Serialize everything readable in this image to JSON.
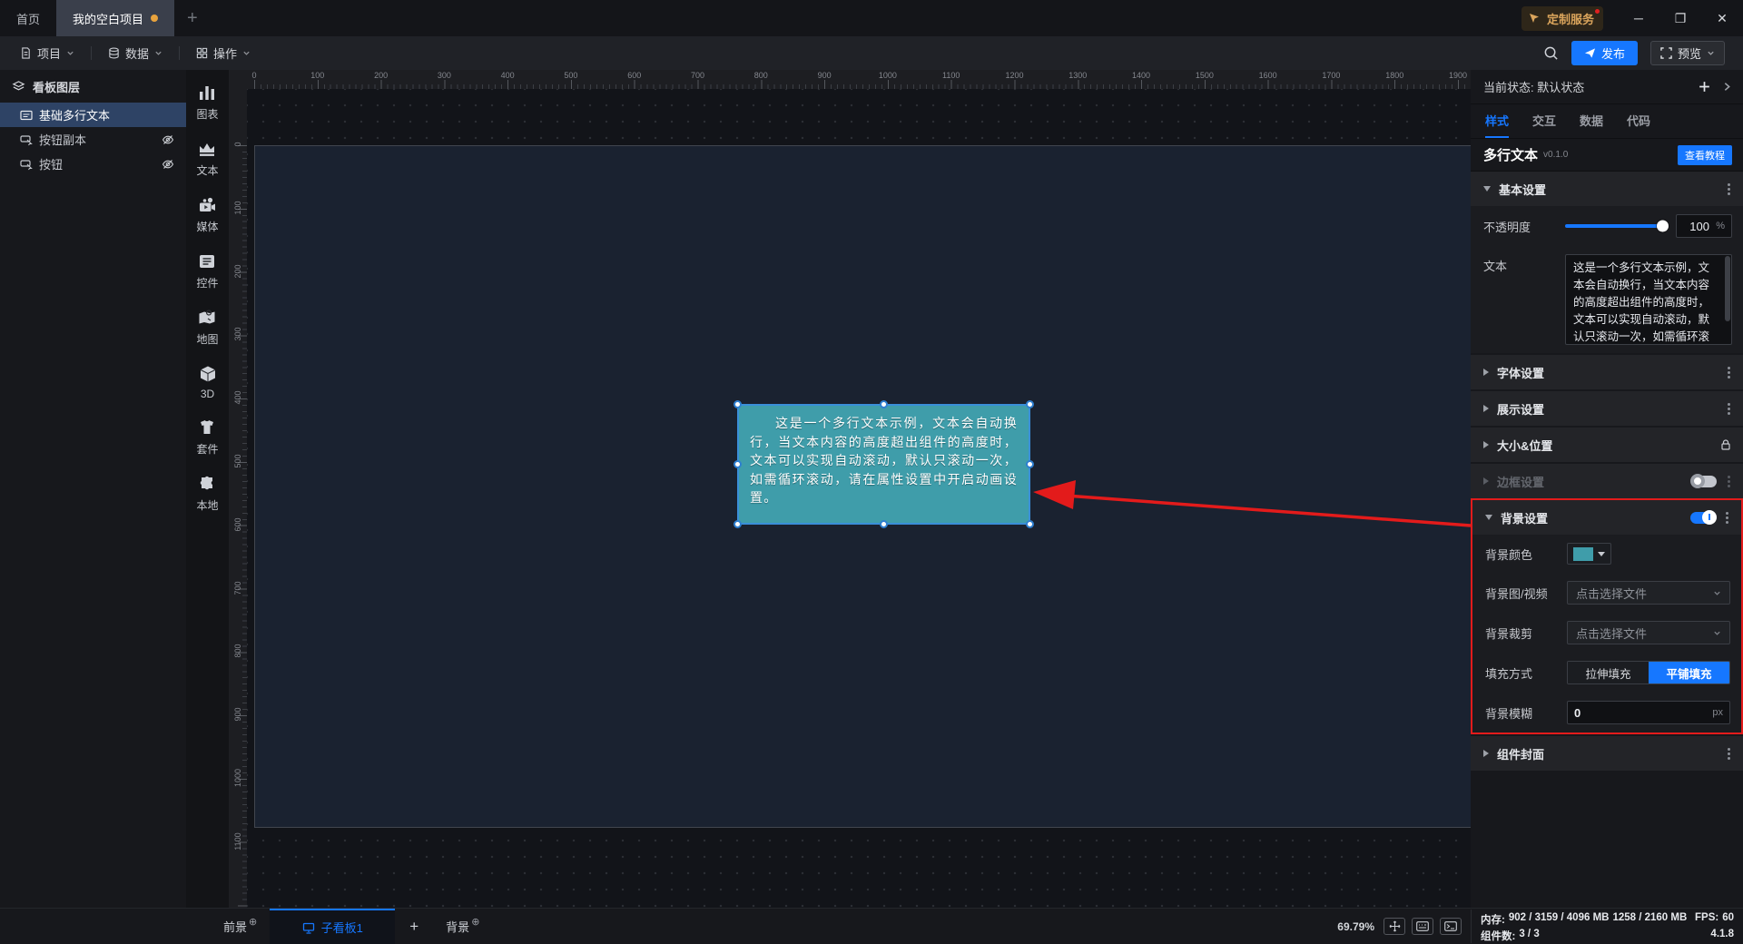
{
  "colors": {
    "accent": "#1677ff",
    "highlight_red": "#e31b1b",
    "component_teal": "#3f9daa",
    "modified_dot": "#e8a33d"
  },
  "top_bar": {
    "home_tab": "首页",
    "project_tab": "我的空白项目",
    "custom_service": "定制服务",
    "minimize": "─",
    "maximize": "❐",
    "close": "✕"
  },
  "menu_bar": {
    "items": [
      {
        "label": "项目"
      },
      {
        "label": "数据"
      },
      {
        "label": "操作"
      }
    ],
    "publish": "发布",
    "preview": "预览"
  },
  "layers_panel": {
    "title": "看板图层",
    "items": [
      {
        "label": "基础多行文本"
      },
      {
        "label": "按钮副本"
      },
      {
        "label": "按钮"
      }
    ]
  },
  "asset_toolbar": {
    "items": [
      {
        "label": "图表"
      },
      {
        "label": "文本"
      },
      {
        "label": "媒体"
      },
      {
        "label": "控件"
      },
      {
        "label": "地图"
      },
      {
        "label": "3D"
      },
      {
        "label": "套件"
      },
      {
        "label": "本地"
      }
    ]
  },
  "canvas": {
    "h_ruler": [
      0,
      100,
      200,
      300,
      400,
      500,
      600,
      700,
      800,
      900,
      1000,
      1100,
      1200,
      1300,
      1400,
      1500,
      1600,
      1700,
      1800,
      1900
    ],
    "v_ruler": [
      0,
      100,
      200,
      300,
      400,
      500,
      600,
      700,
      800,
      900,
      1000,
      1100
    ],
    "component_text": "这是一个多行文本示例，文本会自动换行，当文本内容的高度超出组件的高度时，文本可以实现自动滚动，默认只滚动一次，如需循环滚动，请在属性设置中开启动画设置。"
  },
  "inspector": {
    "state_label": "当前状态: 默认状态",
    "tabs": [
      {
        "label": "样式"
      },
      {
        "label": "交互"
      },
      {
        "label": "数据"
      },
      {
        "label": "代码"
      }
    ],
    "component_name": "多行文本",
    "component_version": "v0.1.0",
    "tutorial_button": "查看教程",
    "basic": {
      "title": "基本设置",
      "opacity_label": "不透明度",
      "opacity_value": "100",
      "opacity_unit": "%",
      "text_label": "文本",
      "text_value": "这是一个多行文本示例，文本会自动换行，当文本内容的高度超出组件的高度时，文本可以实现自动滚动，默认只滚动一次，如需循环滚动，请在属性设置中开启动画设置。"
    },
    "font": {
      "title": "字体设置"
    },
    "display": {
      "title": "展示设置"
    },
    "size": {
      "title": "大小&位置"
    },
    "border": {
      "title": "边框设置"
    },
    "background": {
      "title": "背景设置",
      "color_label": "背景颜色",
      "media_label": "背景图/视频",
      "crop_label": "背景裁剪",
      "file_placeholder": "点击选择文件",
      "fill_label": "填充方式",
      "fill_stretch": "拉伸填充",
      "fill_tile": "平铺填充",
      "blur_label": "背景模糊",
      "blur_value": "0",
      "blur_unit": "px"
    },
    "cover": {
      "title": "组件封面"
    }
  },
  "bottom_bar": {
    "foreground": "前景",
    "board_tab": "子看板1",
    "background": "背景",
    "zoom": "69.79%",
    "memory_label": "内存:",
    "memory_value": "902 / 3159 / 4096 MB",
    "memory_secondary": "1258 / 2160 MB",
    "fps_label": "FPS:",
    "fps_value": "60",
    "components_label": "组件数:",
    "components_value": "3 / 3",
    "version": "4.1.8"
  }
}
